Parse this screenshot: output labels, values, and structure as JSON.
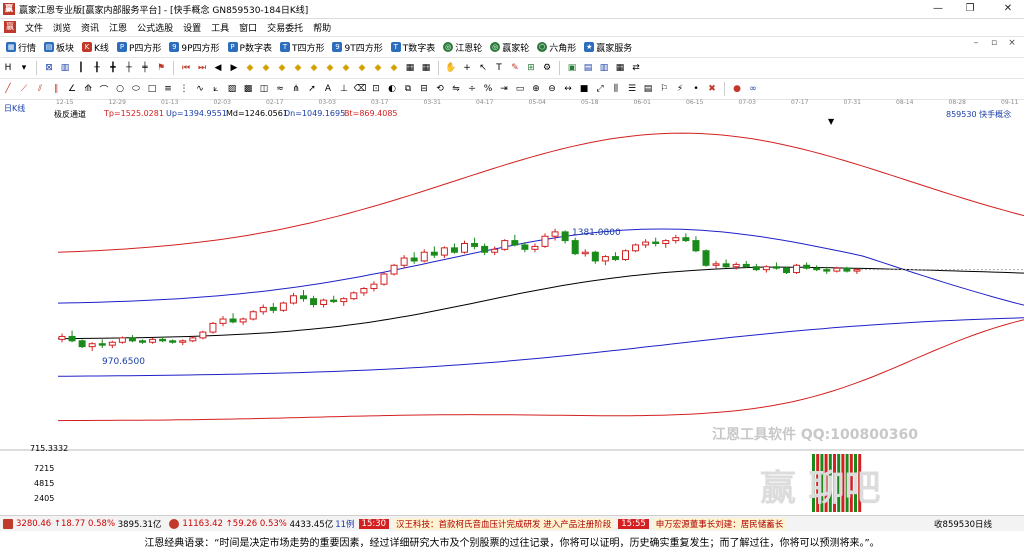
{
  "window": {
    "title": "赢家江恩专业版[赢家内部服务平台] - [快手概念  GN859530-184日K线]",
    "controls": [
      "—",
      "❐",
      "✕"
    ]
  },
  "menu": {
    "items": [
      "文件",
      "浏览",
      "资讯",
      "江恩",
      "公式选股",
      "设置",
      "工具",
      "窗口",
      "交易委托",
      "帮助"
    ]
  },
  "nav": {
    "items": [
      {
        "label": "行情"
      },
      {
        "label": "板块"
      },
      {
        "label": "K线"
      },
      {
        "label": "P四方形"
      },
      {
        "label": "9P四方形"
      },
      {
        "label": "P数字表"
      },
      {
        "label": "T四方形"
      },
      {
        "label": "9T四方形"
      },
      {
        "label": "T数字表"
      },
      {
        "label": "江恩轮"
      },
      {
        "label": "赢家轮"
      },
      {
        "label": "六角形"
      },
      {
        "label": "赢家服务"
      }
    ]
  },
  "chart_header": {
    "period": "日K线",
    "indicator": "极反通道",
    "tp": "Tp=1525.0281",
    "up": "Up=1394.9551",
    "md": "Md=1246.0561",
    "dn": "Dn=1049.1695",
    "bt": "Bt=869.4085",
    "code_name": "859530  快手概念"
  },
  "date_axis": [
    "12-15",
    "12-29",
    "01-13",
    "02-03",
    "02-17",
    "03-03",
    "03-17",
    "03-31",
    "04-17",
    "05-04",
    "05-18",
    "06-01",
    "06-15",
    "07-03",
    "07-17",
    "07-31",
    "08-14",
    "08-28",
    "09-11"
  ],
  "annotations": {
    "high": "1381.0800",
    "low": "970.6500"
  },
  "volume_axis": [
    "715.3332",
    "7215",
    "4815",
    "2405"
  ],
  "watermark": {
    "line1": "江恩工具软件  QQ:100800360",
    "line2": "赢  聊吧"
  },
  "chart_data": {
    "type": "candlestick",
    "xlabel": "",
    "ylabel": "",
    "indicator_lines": [
      "Tp",
      "Up",
      "Md",
      "Dn",
      "Bt"
    ],
    "series_colors": {
      "Tp": "#d42020",
      "Up": "#2020c8",
      "Md": "#000000",
      "Dn": "#2020c8",
      "Bt": "#d42020",
      "up_candle": "#d42020",
      "down_candle": "#1a8a1a"
    },
    "price_range": [
      650,
      1800
    ],
    "candles": [
      [
        1000,
        1020,
        990,
        1010
      ],
      [
        1010,
        1030,
        990,
        995
      ],
      [
        995,
        1000,
        970,
        975
      ],
      [
        975,
        990,
        960,
        985
      ],
      [
        985,
        1000,
        970,
        980
      ],
      [
        980,
        995,
        970,
        990
      ],
      [
        990,
        1010,
        985,
        1005
      ],
      [
        1005,
        1015,
        990,
        995
      ],
      [
        995,
        1000,
        985,
        990
      ],
      [
        990,
        1005,
        985,
        1000
      ],
      [
        1000,
        1010,
        990,
        995
      ],
      [
        995,
        1000,
        985,
        990
      ],
      [
        990,
        1000,
        980,
        995
      ],
      [
        995,
        1010,
        990,
        1005
      ],
      [
        1005,
        1030,
        1000,
        1025
      ],
      [
        1025,
        1060,
        1020,
        1055
      ],
      [
        1055,
        1080,
        1045,
        1070
      ],
      [
        1070,
        1090,
        1055,
        1060
      ],
      [
        1060,
        1075,
        1050,
        1070
      ],
      [
        1070,
        1100,
        1065,
        1095
      ],
      [
        1095,
        1120,
        1085,
        1110
      ],
      [
        1110,
        1125,
        1090,
        1100
      ],
      [
        1100,
        1130,
        1095,
        1125
      ],
      [
        1125,
        1160,
        1120,
        1150
      ],
      [
        1150,
        1170,
        1130,
        1140
      ],
      [
        1140,
        1150,
        1110,
        1120
      ],
      [
        1120,
        1140,
        1110,
        1135
      ],
      [
        1135,
        1150,
        1125,
        1130
      ],
      [
        1130,
        1145,
        1115,
        1140
      ],
      [
        1140,
        1165,
        1135,
        1160
      ],
      [
        1160,
        1180,
        1150,
        1175
      ],
      [
        1175,
        1200,
        1165,
        1190
      ],
      [
        1190,
        1230,
        1185,
        1225
      ],
      [
        1225,
        1260,
        1220,
        1255
      ],
      [
        1255,
        1290,
        1245,
        1280
      ],
      [
        1280,
        1300,
        1260,
        1270
      ],
      [
        1270,
        1310,
        1265,
        1300
      ],
      [
        1300,
        1320,
        1280,
        1290
      ],
      [
        1290,
        1320,
        1280,
        1315
      ],
      [
        1315,
        1330,
        1295,
        1300
      ],
      [
        1300,
        1340,
        1295,
        1330
      ],
      [
        1330,
        1350,
        1310,
        1320
      ],
      [
        1320,
        1330,
        1290,
        1300
      ],
      [
        1300,
        1320,
        1290,
        1310
      ],
      [
        1310,
        1345,
        1305,
        1340
      ],
      [
        1340,
        1360,
        1320,
        1325
      ],
      [
        1325,
        1335,
        1300,
        1310
      ],
      [
        1310,
        1330,
        1300,
        1320
      ],
      [
        1320,
        1365,
        1315,
        1355
      ],
      [
        1355,
        1381,
        1340,
        1370
      ],
      [
        1370,
        1375,
        1330,
        1340
      ],
      [
        1340,
        1350,
        1290,
        1295
      ],
      [
        1295,
        1310,
        1285,
        1300
      ],
      [
        1300,
        1305,
        1260,
        1270
      ],
      [
        1270,
        1290,
        1255,
        1285
      ],
      [
        1285,
        1300,
        1270,
        1275
      ],
      [
        1275,
        1310,
        1270,
        1305
      ],
      [
        1305,
        1330,
        1300,
        1325
      ],
      [
        1325,
        1345,
        1315,
        1335
      ],
      [
        1335,
        1350,
        1320,
        1330
      ],
      [
        1330,
        1345,
        1315,
        1340
      ],
      [
        1340,
        1360,
        1330,
        1350
      ],
      [
        1350,
        1365,
        1335,
        1340
      ],
      [
        1340,
        1355,
        1300,
        1305
      ],
      [
        1305,
        1310,
        1250,
        1255
      ],
      [
        1255,
        1270,
        1245,
        1260
      ],
      [
        1260,
        1275,
        1245,
        1250
      ],
      [
        1250,
        1265,
        1240,
        1258
      ],
      [
        1258,
        1270,
        1245,
        1250
      ],
      [
        1250,
        1260,
        1235,
        1240
      ],
      [
        1240,
        1255,
        1230,
        1250
      ],
      [
        1250,
        1265,
        1240,
        1245
      ],
      [
        1245,
        1250,
        1225,
        1230
      ],
      [
        1230,
        1260,
        1225,
        1255
      ],
      [
        1255,
        1265,
        1240,
        1245
      ],
      [
        1245,
        1255,
        1235,
        1240
      ],
      [
        1240,
        1250,
        1225,
        1235
      ],
      [
        1235,
        1250,
        1230,
        1245
      ],
      [
        1245,
        1250,
        1230,
        1235
      ],
      [
        1235,
        1245,
        1225,
        1240
      ]
    ]
  },
  "status": {
    "sh_index": "3280.46",
    "sh_change": "↑18.77",
    "sh_pct": "0.58%",
    "sh_amount": "3895.31亿",
    "sz_index": "11163.42",
    "sz_change": "↑59.26",
    "sz_pct": "0.53%",
    "sz_amount": "4433.45亿",
    "count": "11例",
    "time1": "15:30",
    "news1": "汉王科技：首款柯氏音血压计完成研发 进入产品注册阶段",
    "time2": "15:55",
    "news2": "申万宏源董事长刘建：居民储蓄长",
    "right": "收859530日线"
  },
  "footer": {
    "quote": "江恩经典语录：“时间是决定市场走势的重要因素，经过详细研究大市及个别股票的过往记录，你将可以证明，历史确实重复发生；而了解过往，你将可以预测将来。”。"
  }
}
